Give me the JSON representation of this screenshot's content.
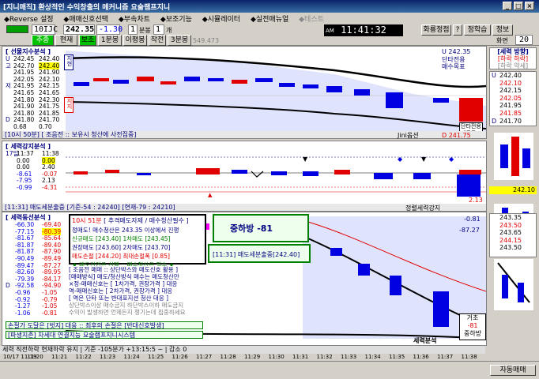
{
  "title": "[지니매직] 환상적인 수익창출의 메커니즘 요술램프지니",
  "menu": [
    "◆Reverse 설정",
    "◆매매신호선택",
    "◆부속차트",
    "◆보조기능",
    "◆시뮬레이터",
    "◆실전매뉴얼",
    "◆테스트"
  ],
  "toolbar": {
    "code": "10IJC",
    "price": "242.35",
    "change": "-1.30",
    "interval_val": "1",
    "interval_unit": "분봉",
    "count": "1",
    "count_unit": "개",
    "clock": "11:41:32",
    "clock_label": "AM",
    "btn_reverse": "화룡정점",
    "btn_help": "?",
    "btn_learn": "정학습",
    "btn_info": "정보",
    "screen_label": "화면",
    "screen_num": "20",
    "value_549": "549.473",
    "tabs": [
      "추종",
      "현재",
      "보조",
      "1분봉",
      "이평봉",
      "작전",
      "3분봉"
    ]
  },
  "panel1": {
    "header": "[ 선물지수분석 ]",
    "rows": [
      {
        "k": "U",
        "v1": "242.45",
        "v2": "242.40"
      },
      {
        "k": "고",
        "v1": "242.70",
        "v2": "242.40"
      },
      {
        "k": "",
        "v1": "241.95",
        "v2": "241.90"
      },
      {
        "k": "",
        "v1": "242.05",
        "v2": "242.10"
      },
      {
        "k": "저",
        "v1": "241.95",
        "v2": "242.15"
      },
      {
        "k": "",
        "v1": "241.65",
        "v2": "241.65"
      },
      {
        "k": "",
        "v1": "241.80",
        "v2": "242.30"
      },
      {
        "k": "",
        "v1": "241.90",
        "v2": "241.75"
      },
      {
        "k": "",
        "v1": "241.80",
        "v2": "241.85"
      },
      {
        "k": "D",
        "v1": "241.80",
        "v2": "241.70"
      },
      {
        "k": "",
        "v1": "0.68",
        "v2": "0.70"
      }
    ],
    "tag_top": "지현",
    "tag_bot": "지지",
    "right_labels": [
      "U 242.35",
      "단타전용",
      "매수목표"
    ],
    "right_box": "단타전용\n매도목표",
    "footer_left": "[10시 50분] [ 조음전 :: 보유시 청산에 사전집중]",
    "footer_right": "Jini옵션",
    "footer_d": "D 241.75"
  },
  "panel2": {
    "header": "[ 세력강지분석 ]",
    "rows": [
      {
        "k": "17일",
        "v1": "11:37",
        "v2": "11:38"
      },
      {
        "k": "",
        "v1": "0.00",
        "v2": "0.00"
      },
      {
        "k": "",
        "v1": "0.00",
        "v2": "2.40"
      },
      {
        "k": "",
        "v1": "-8.61",
        "v2": "-0.07"
      },
      {
        "k": "",
        "v1": "-7.95",
        "v2": "2.13"
      },
      {
        "k": "",
        "v1": "-0.99",
        "v2": "-4.31"
      }
    ],
    "footer_left": "[11:31] 매도세분출중 [기준-54 : 24240] [현재-79 : 24210]",
    "footer_right": "정렬세력강지",
    "value_right": "2.13"
  },
  "panel3": {
    "header": "[ 세력동선분석 ]",
    "rows": [
      {
        "k": "",
        "v1": "-66.30",
        "v2": "-69.40"
      },
      {
        "k": "",
        "v1": "-77.15",
        "v2": "-80.39"
      },
      {
        "k": "",
        "v1": "-81.67",
        "v2": "-85.64"
      },
      {
        "k": "",
        "v1": "-81.87",
        "v2": "-89.40"
      },
      {
        "k": "",
        "v1": "-81.87",
        "v2": "-87.90"
      },
      {
        "k": "",
        "v1": "-90.49",
        "v2": "-89.49"
      },
      {
        "k": "",
        "v1": "-89.47",
        "v2": "-87.27"
      },
      {
        "k": "",
        "v1": "-82.60",
        "v2": "-89.95"
      },
      {
        "k": "",
        "v1": "-79.39",
        "v2": "-84.17"
      },
      {
        "k": "D",
        "v1": "-92.58",
        "v2": "-94.90"
      },
      {
        "k": "",
        "v1": "-0.96",
        "v2": "-1.05"
      },
      {
        "k": "",
        "v1": "-0.92",
        "v2": "-0.79"
      },
      {
        "k": "",
        "v1": "-1.27",
        "v2": "-1.05"
      },
      {
        "k": "",
        "v1": "-1.06",
        "v2": "-0.81"
      }
    ],
    "info_time": "10시 51분",
    "info_title": "[ 추격매도자제 / 매수청산필수 ]",
    "info_lines": [
      "정매도! 매수청산은 243.35 이상에서 진행",
      "신규매도 [243.40]   1차매도 [243.45]",
      "권장매도 [243.60]   2차매도 [243.70]",
      "매도손절 [244.20]   최대손절폭 [0.85]",
      "★ 매도진입은 선택 :: 매수청산은 필수 ★"
    ],
    "notes": [
      "[ 조음전 매매 :: 상단박스와 매도신호 활용 ]",
      "[매매방식] 매도/청산방식 매수는 매도청산만",
      "×정-매매신호는 [ 1차가격, 권장가격 ] 대응",
      "역-매매신호는 [ 2차가격, 권장가격 ] 대응",
      "[ 역은 단타 또는 반대포지션 청산 대응 ]",
      "상단박스이상 매수금지 하단박스이하 매도금지",
      "수익이 발생하면 언제든지 챙기는데 집중하세요"
    ],
    "footer_line1": "손절가 도달은 [벗지] 대응 :: 최후의 손절은 [반대신호발생]",
    "footer_line2": "[파생지존] 차세대 연결지능 요술램프지니시스템",
    "callout": "중하방 -81",
    "box": "[11:31] 매도세분출중[242.40]",
    "right_vals": [
      "-0.81",
      "-87.27"
    ],
    "right_bottom": [
      "거초",
      "-81",
      "중하방"
    ],
    "footer_right": "세력분석"
  },
  "status": "세력 직전하락 현재하락 유지 | 기준 -105분가 +13:15:5 ~ | 감소 0",
  "time_axis": [
    "10/17 11:19",
    "11:20",
    "11:21",
    "11:22",
    "11:23",
    "11:24",
    "11:25",
    "11:26",
    "11:27",
    "11:28",
    "11:29",
    "11:30",
    "11:31",
    "11:32",
    "11:33",
    "11:34",
    "11:35",
    "11:36",
    "11:37",
    "11:38"
  ],
  "right_panel": {
    "header": "[세력 방향]",
    "sub": "[하락 하락]",
    "sub2": "[하락 약세]",
    "rows": [
      {
        "k": "U",
        "v": "242.40"
      },
      {
        "k": "",
        "v": "242.10"
      },
      {
        "k": "",
        "v": "242.15"
      },
      {
        "k": "",
        "v": "242.05"
      },
      {
        "k": "",
        "v": "241.95"
      },
      {
        "k": "",
        "v": "241.85"
      },
      {
        "k": "D",
        "v": "241.70"
      }
    ],
    "bottom_val": "242.10",
    "p3_rows": [
      {
        "k": "",
        "v": "243.35"
      },
      {
        "k": "",
        "v": "243.50"
      },
      {
        "k": "",
        "v": "243.65"
      },
      {
        "k": "",
        "v": "244.15"
      },
      {
        "k": "",
        "v": "243.50"
      }
    ],
    "auto_label": "자동매매"
  },
  "colors": {
    "up": "#e00000",
    "down": "#0000e0",
    "panel_bg": "#ffffff",
    "band": "#c8d0f8"
  }
}
